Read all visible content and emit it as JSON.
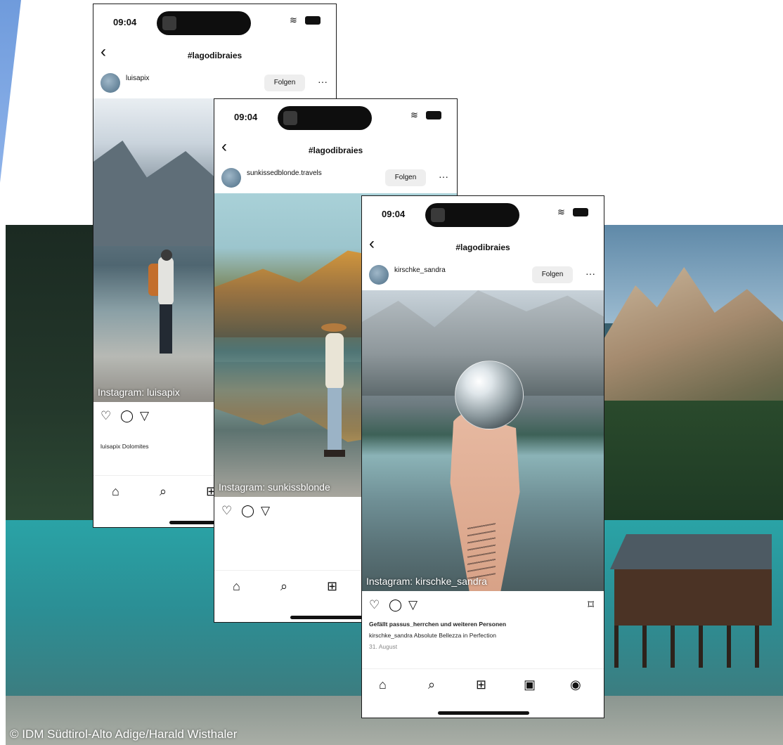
{
  "credit": "© IDM Südtirol-Alto Adige/Harald Wisthaler",
  "icons": {
    "back": "chevron-left-icon",
    "like": "heart-icon",
    "comment": "comment-icon",
    "share": "send-icon",
    "save": "bookmark-icon",
    "home": "home-icon",
    "search": "search-icon",
    "create": "plus-square-icon",
    "reels": "reels-icon",
    "profile": "profile-icon"
  },
  "colors": {
    "accent_bar": "#7fa6e4",
    "lake": "#2aa3a6"
  },
  "phones": [
    {
      "time": "09:04",
      "hashtag": "#lagodibraies",
      "username": "luisapix",
      "follow_label": "Folgen",
      "photo_label": "Instagram: luisapix",
      "caption_line2": "luisapix Dolomites"
    },
    {
      "time": "09:04",
      "hashtag": "#lagodibraies",
      "username": "sunkissedblonde.travels",
      "follow_label": "Folgen",
      "photo_label": "Instagram: sunkissblonde"
    },
    {
      "time": "09:04",
      "hashtag": "#lagodibraies",
      "username": "kirschke_sandra",
      "follow_label": "Folgen",
      "photo_label": "Instagram: kirschke_sandra",
      "caption_line1": "Gefällt passus_herrchen und weiteren Personen",
      "caption_line2": "kirschke_sandra Absolute Bellezza in Perfection",
      "caption_line3": "31. August"
    }
  ]
}
